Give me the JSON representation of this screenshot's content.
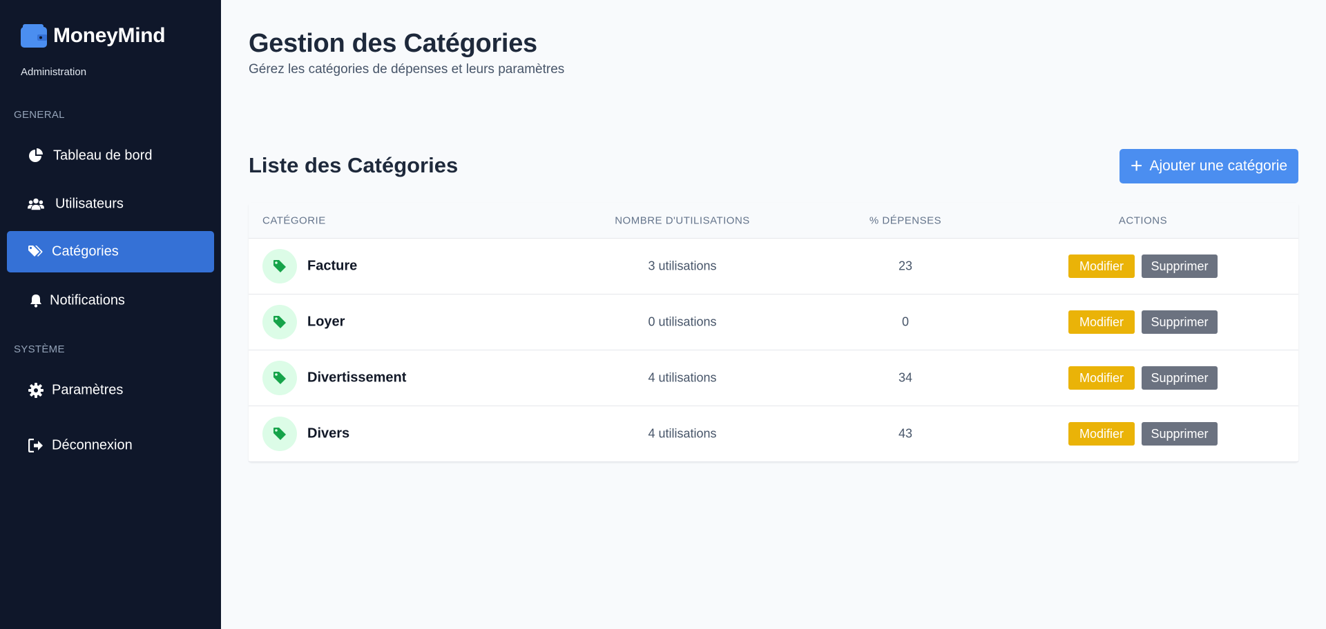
{
  "brand": {
    "name": "MoneyMind",
    "subtitle": "Administration"
  },
  "sidebar": {
    "sections": [
      {
        "label": "GENERAL"
      },
      {
        "label": "SYSTÈME"
      }
    ],
    "items": [
      {
        "label": "Tableau de bord",
        "icon": "pie-chart-icon"
      },
      {
        "label": "Utilisateurs",
        "icon": "users-icon"
      },
      {
        "label": "Catégories",
        "icon": "tags-icon",
        "active": true
      },
      {
        "label": "Notifications",
        "icon": "bell-icon"
      },
      {
        "label": "Paramètres",
        "icon": "gear-icon"
      },
      {
        "label": "Déconnexion",
        "icon": "logout-icon"
      }
    ]
  },
  "header": {
    "title": "Gestion des Catégories",
    "subtitle": "Gérez les catégories de dépenses et leurs paramètres"
  },
  "list": {
    "title": "Liste des Catégories",
    "add_button": "Ajouter une catégorie",
    "columns": [
      "CATÉGORIE",
      "NOMBRE D'UTILISATIONS",
      "% DÉPENSES",
      "ACTIONS"
    ],
    "rows": [
      {
        "name": "Facture",
        "uses": "3 utilisations",
        "percent": "23",
        "edit": "Modifier",
        "delete": "Supprimer"
      },
      {
        "name": "Loyer",
        "uses": "0 utilisations",
        "percent": "0",
        "edit": "Modifier",
        "delete": "Supprimer"
      },
      {
        "name": "Divertissement",
        "uses": "4 utilisations",
        "percent": "34",
        "edit": "Modifier",
        "delete": "Supprimer"
      },
      {
        "name": "Divers",
        "uses": "4 utilisations",
        "percent": "43",
        "edit": "Modifier",
        "delete": "Supprimer"
      }
    ]
  },
  "colors": {
    "sidebar_bg": "#0f172a",
    "active_item": "#3571d6",
    "accent_blue": "#4b8ef0",
    "edit_yellow": "#eab308",
    "delete_gray": "#6b7280",
    "tag_green": "#16a34a",
    "tag_bg": "#dcfce7"
  }
}
